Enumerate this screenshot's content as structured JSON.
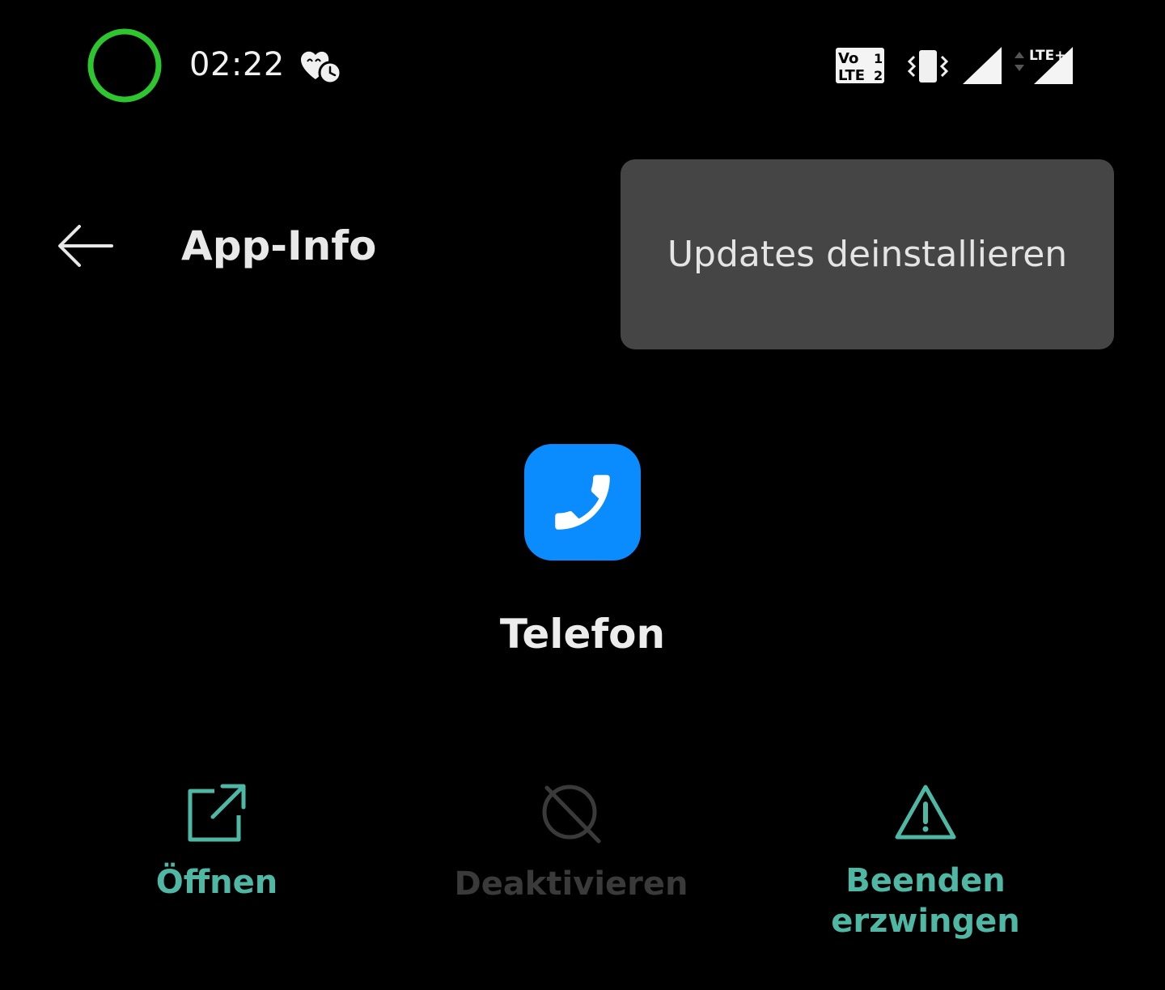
{
  "status_bar": {
    "time": "02:22",
    "icons": [
      "progress-ring-icon",
      "notification-alarm-icon",
      "volte-icon",
      "vibrate-icon",
      "signal-icon",
      "signal-lte-plus-icon"
    ],
    "volte_line1": "Vo",
    "volte_sim1": "1",
    "volte_line2": "LTE",
    "volte_sim2": "2",
    "network_type": "LTE+",
    "ring_color": "#2ec62e"
  },
  "app_bar": {
    "title": "App-Info",
    "back_icon": "arrow-left-icon"
  },
  "popup_menu": {
    "items": [
      {
        "label": "Updates deinstallieren"
      }
    ]
  },
  "app": {
    "name": "Telefon",
    "icon": "phone-icon",
    "icon_color": "#0a8cff"
  },
  "actions": [
    {
      "label": "Öffnen",
      "icon": "open-external-icon",
      "enabled": true
    },
    {
      "label": "Deaktivieren",
      "icon": "disable-icon",
      "enabled": false
    },
    {
      "label": "Beenden erzwingen",
      "icon": "warning-icon",
      "enabled": true
    }
  ],
  "colors": {
    "accent": "#4fb8a4",
    "background": "#000000",
    "menu_background": "#454545",
    "disabled": "#3a3a3a"
  }
}
